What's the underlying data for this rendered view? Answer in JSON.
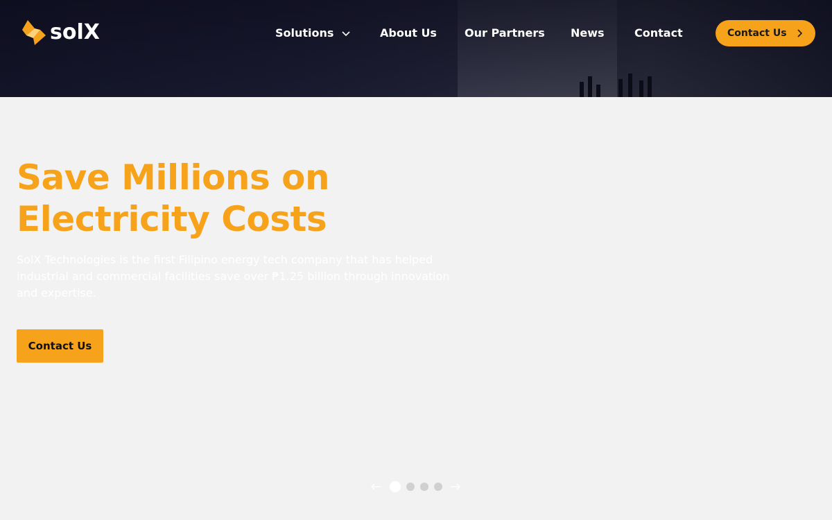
{
  "brand": {
    "name": "solX",
    "accent": "#f7a21b",
    "header_bg": "#1c1d33"
  },
  "nav": {
    "items": [
      {
        "label": "Solutions",
        "has_dropdown": true,
        "icon": "chevron-down-icon"
      },
      {
        "label": "About Us"
      },
      {
        "label": "Our Partners"
      },
      {
        "label": "News"
      },
      {
        "label": "Contact"
      }
    ],
    "cta_label": "Contact Us",
    "cta_icon": "chevron-right-icon"
  },
  "hero": {
    "title_line1": "Save Millions on",
    "title_line2": "Electricity Costs",
    "description": "SolX Technologies is the first Filipino energy tech company that has helped industrial and commercial facilities save over ₱1.25 billion through innovation and expertise.",
    "cta_label": "Contact Us"
  },
  "carousel": {
    "prev_icon": "arrow-left-icon",
    "next_icon": "arrow-right-icon",
    "slide_count": 4,
    "active_slide": 1
  }
}
